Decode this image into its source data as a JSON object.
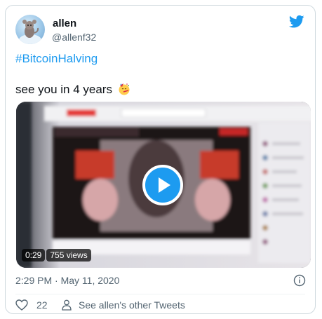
{
  "author": {
    "name": "allen",
    "handle": "@allenf32",
    "avatar": "avatar"
  },
  "brand_icon": "twitter-bird-icon",
  "tweet": {
    "hashtag": "#BitcoinHalving",
    "text": "see you in 4 years",
    "emoji": "party-face-emoji"
  },
  "media": {
    "duration": "0:29",
    "views": "755 views",
    "play_icon": "play-icon"
  },
  "meta": {
    "timestamp": "2:29 PM · May 11, 2020",
    "info_icon": "info-icon"
  },
  "actions": {
    "like_count": "22",
    "like_icon": "heart-icon",
    "other_tweets_label": "See allen's other Tweets",
    "person_icon": "person-icon"
  },
  "colors": {
    "accent": "#1d9bf0",
    "text": "#0f1419",
    "muted": "#536471",
    "border": "#cfd9de"
  }
}
